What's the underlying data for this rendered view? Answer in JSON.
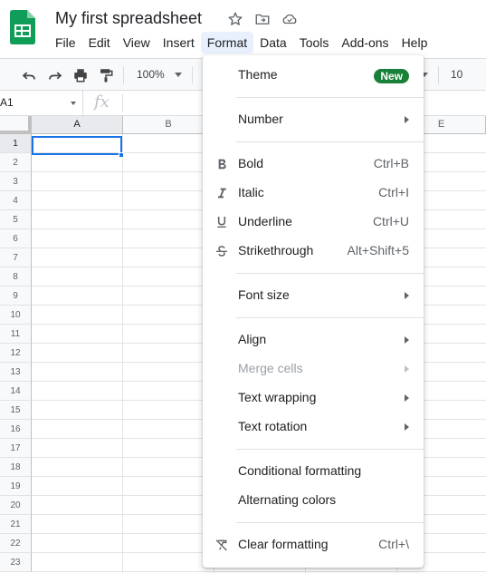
{
  "doc": {
    "title": "My first spreadsheet"
  },
  "menubar": {
    "items": [
      {
        "label": "File"
      },
      {
        "label": "Edit"
      },
      {
        "label": "View"
      },
      {
        "label": "Insert"
      },
      {
        "label": "Format",
        "active": true
      },
      {
        "label": "Data"
      },
      {
        "label": "Tools"
      },
      {
        "label": "Add-ons"
      },
      {
        "label": "Help"
      }
    ]
  },
  "toolbar": {
    "zoom": "100%",
    "font_size": "10",
    "icons": [
      "undo-icon",
      "redo-icon",
      "print-icon",
      "paint-format-icon"
    ]
  },
  "formula_bar": {
    "cell_ref": "A1",
    "fx": "fx"
  },
  "grid": {
    "columns": [
      "A",
      "B",
      "E"
    ],
    "rows": [
      "1",
      "2",
      "3",
      "4",
      "5",
      "6",
      "7",
      "8",
      "9",
      "10",
      "11",
      "12",
      "13",
      "14",
      "15",
      "16",
      "17",
      "18",
      "19",
      "20",
      "21",
      "22",
      "23"
    ],
    "active_cell": "A1"
  },
  "format_menu": {
    "theme": {
      "label": "Theme",
      "badge": "New"
    },
    "number": {
      "label": "Number"
    },
    "bold": {
      "label": "Bold",
      "shortcut": "Ctrl+B",
      "icon": "bold-icon"
    },
    "italic": {
      "label": "Italic",
      "shortcut": "Ctrl+I",
      "icon": "italic-icon"
    },
    "underline": {
      "label": "Underline",
      "shortcut": "Ctrl+U",
      "icon": "underline-icon"
    },
    "strikethrough": {
      "label": "Strikethrough",
      "shortcut": "Alt+Shift+5",
      "icon": "strikethrough-icon"
    },
    "font_size": {
      "label": "Font size"
    },
    "align": {
      "label": "Align"
    },
    "merge_cells": {
      "label": "Merge cells",
      "disabled": true
    },
    "text_wrapping": {
      "label": "Text wrapping"
    },
    "text_rotation": {
      "label": "Text rotation"
    },
    "conditional_formatting": {
      "label": "Conditional formatting"
    },
    "alternating_colors": {
      "label": "Alternating colors"
    },
    "clear_formatting": {
      "label": "Clear formatting",
      "shortcut": "Ctrl+\\",
      "icon": "clear-formatting-icon"
    }
  },
  "colors": {
    "accent": "#1a73e8",
    "badge_new": "#188038",
    "sheets_green": "#0f9d58"
  }
}
